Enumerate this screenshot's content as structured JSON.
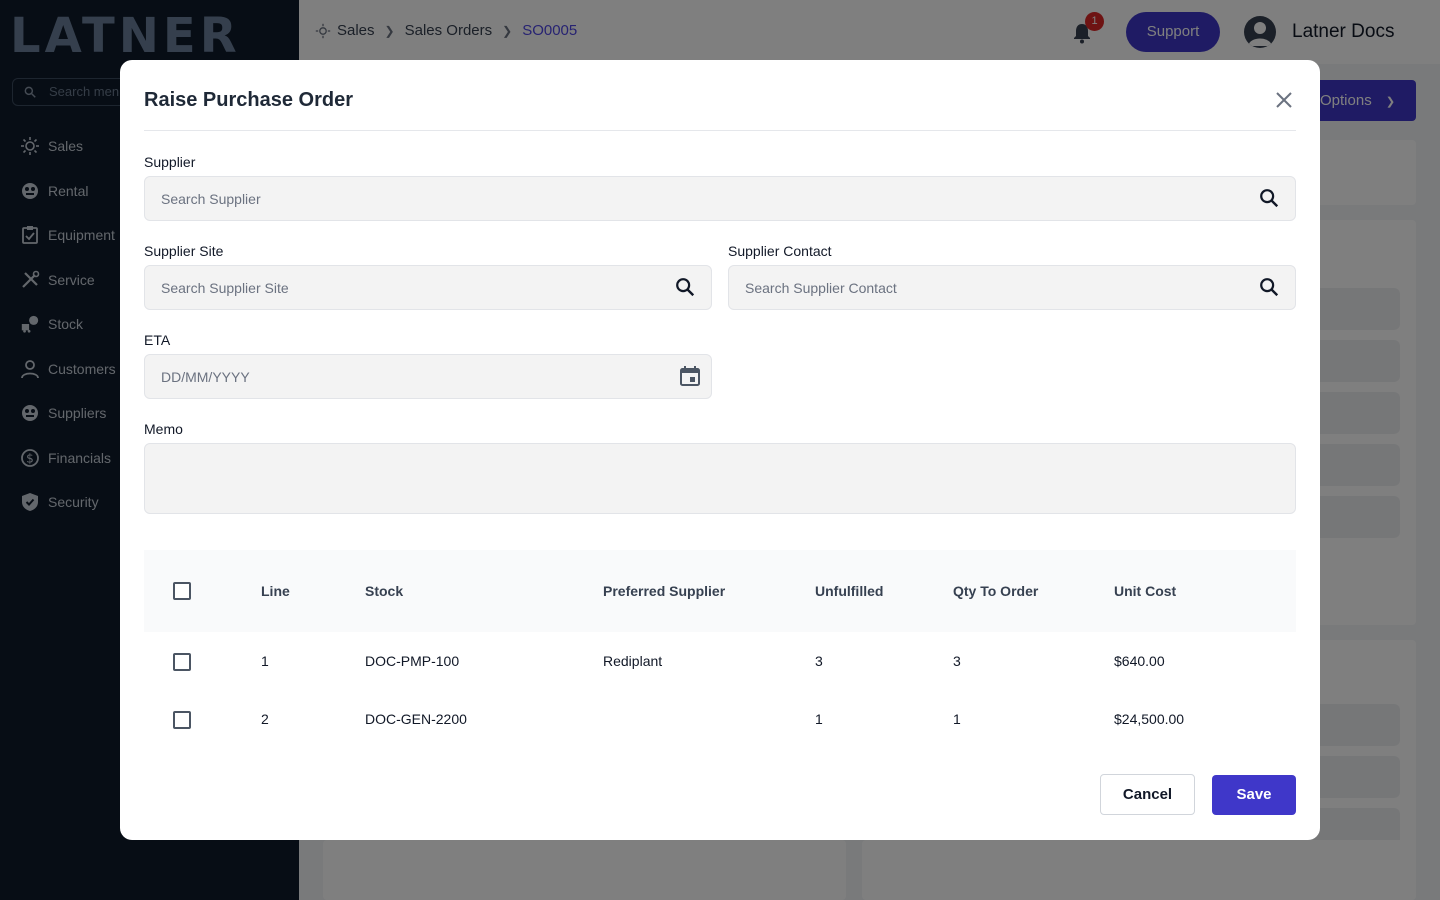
{
  "sidebar": {
    "logo": "LATNER",
    "search_placeholder": "Search menu",
    "items": [
      {
        "label": "Sales",
        "icon": "sales-icon"
      },
      {
        "label": "Rental",
        "icon": "rental-icon"
      },
      {
        "label": "Equipment",
        "icon": "equipment-icon"
      },
      {
        "label": "Service",
        "icon": "service-icon"
      },
      {
        "label": "Stock",
        "icon": "stock-icon"
      },
      {
        "label": "Customers",
        "icon": "customers-icon"
      },
      {
        "label": "Suppliers",
        "icon": "suppliers-icon"
      },
      {
        "label": "Financials",
        "icon": "financials-icon"
      },
      {
        "label": "Security",
        "icon": "security-icon"
      }
    ]
  },
  "topbar": {
    "breadcrumb": [
      "Sales",
      "Sales Orders",
      "SO0005"
    ],
    "notification_count": "1",
    "support_label": "Support",
    "user_name": "Latner Docs"
  },
  "page": {
    "options_label": "Options"
  },
  "modal": {
    "title": "Raise Purchase Order",
    "supplier": {
      "label": "Supplier",
      "placeholder": "Search Supplier"
    },
    "supplier_site": {
      "label": "Supplier Site",
      "placeholder": "Search Supplier Site"
    },
    "supplier_contact": {
      "label": "Supplier Contact",
      "placeholder": "Search Supplier Contact"
    },
    "eta": {
      "label": "ETA",
      "placeholder": "DD/MM/YYYY"
    },
    "memo": {
      "label": "Memo",
      "value": ""
    },
    "table": {
      "columns": [
        "Line",
        "Stock",
        "Preferred Supplier",
        "Unfulfilled",
        "Qty To Order",
        "Unit Cost"
      ],
      "rows": [
        {
          "line": "1",
          "stock": "DOC-PMP-100",
          "preferred_supplier": "Rediplant",
          "unfulfilled": "3",
          "qty_to_order": "3",
          "unit_cost": "$640.00"
        },
        {
          "line": "2",
          "stock": "DOC-GEN-2200",
          "preferred_supplier": "",
          "unfulfilled": "1",
          "qty_to_order": "1",
          "unit_cost": "$24,500.00"
        }
      ]
    },
    "cancel_label": "Cancel",
    "save_label": "Save"
  },
  "colors": {
    "sidebar_bg": "#0f1b2a",
    "primary": "#3f37c9",
    "breadcrumb_active": "#4f46e5",
    "badge": "#dc2626"
  }
}
